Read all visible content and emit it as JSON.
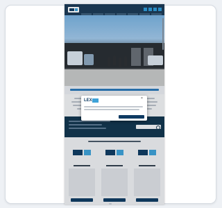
{
  "page": {
    "background": "#eef1f5",
    "card_border": "#d6dbe2"
  },
  "site": {
    "header_color": "#1c3a56",
    "language_icons": [
      "flag-icon",
      "flag-icon",
      "flag-icon",
      "flag-icon"
    ],
    "nav_items_count_visible": 7
  },
  "hero": {
    "icon": "photo-icon"
  },
  "modal": {
    "logo_text": "LEX",
    "close_glyph": "×",
    "body_text": "",
    "settings_label": "",
    "accept_label": ""
  },
  "products": {
    "columns": [
      {
        "logo": "brand-logo-icon"
      },
      {
        "logo": "brand-logo-icon"
      },
      {
        "logo": "brand-logo-icon"
      }
    ]
  },
  "colors": {
    "primary": "#0f3b63",
    "accent": "#3ea2d8",
    "heading": "#2b79b8",
    "band": "#12364f"
  }
}
